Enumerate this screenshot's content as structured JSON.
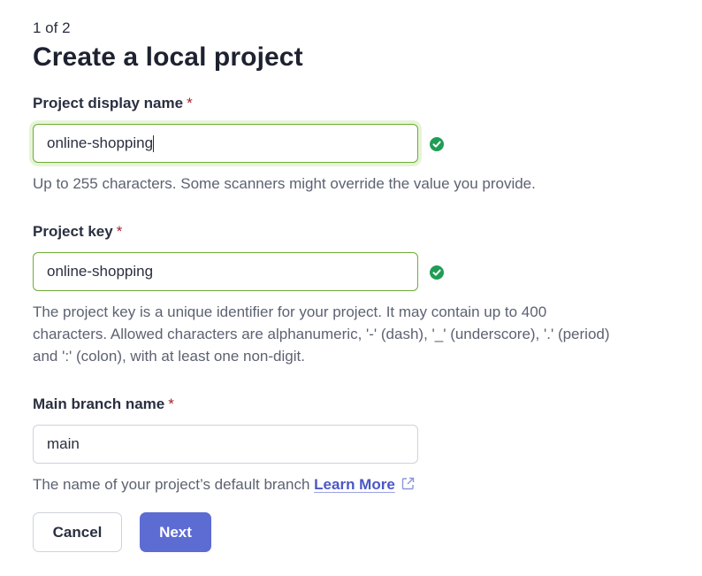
{
  "step": "1 of 2",
  "title": "Create a local project",
  "fields": {
    "display_name": {
      "label": "Project display name",
      "required_mark": "*",
      "value": "online-shopping",
      "help": "Up to 255 characters. Some scanners might override the value you provide."
    },
    "project_key": {
      "label": "Project key",
      "required_mark": "*",
      "value": "online-shopping",
      "help_line1": "The project key is a unique identifier for your project. It may contain up to 400",
      "help_line2": "characters. Allowed characters are alphanumeric, '-' (dash), '_' (underscore), '.' (period)",
      "help_line3": "and ':' (colon), with at least one non-digit."
    },
    "main_branch": {
      "label": "Main branch name",
      "required_mark": "*",
      "value": "main",
      "help": "The name of your project’s default branch",
      "link_label": "Learn More"
    }
  },
  "buttons": {
    "cancel": "Cancel",
    "next": "Next"
  },
  "colors": {
    "accent": "#5d6cd3",
    "valid_border": "#6fac36",
    "check": "#1f9d55",
    "required": "#a8202b"
  },
  "icons": {
    "valid": "check-circle-icon",
    "external": "external-link-icon"
  }
}
